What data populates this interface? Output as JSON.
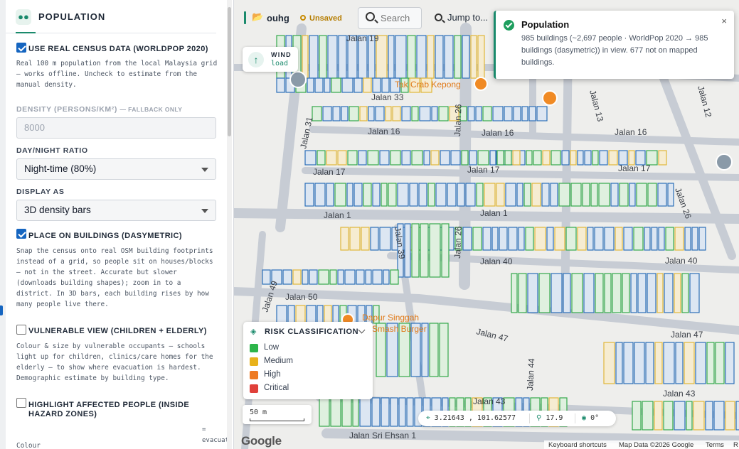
{
  "panel": {
    "title": "POPULATION",
    "census": {
      "checked": true,
      "label": "USE REAL CENSUS DATA (WORLDPOP 2020)",
      "desc": "Real 100 m population from the local Malaysia grid — works offline. Uncheck to estimate from the manual density."
    },
    "density": {
      "label": "DENSITY (PERSONS/KM²)",
      "note": "— FALLBACK ONLY",
      "value": "8000"
    },
    "ratio": {
      "label": "DAY/NIGHT RATIO",
      "selected": "Night-time (80%)"
    },
    "display": {
      "label": "DISPLAY AS",
      "selected": "3D density bars"
    },
    "dasymetric": {
      "checked": true,
      "label": "PLACE ON BUILDINGS (DASYMETRIC)",
      "desc": "Snap the census onto real OSM building footprints instead of a grid, so people sit on houses/blocks — not in the street. Accurate but slower (downloads building shapes); zoom in to a district. In 3D bars, each building rises by how many people live there."
    },
    "vulnerable": {
      "checked": false,
      "label": "VULNERABLE VIEW (CHILDREN + ELDERLY)",
      "desc": "Colour & size by vulnerable occupants — schools light up for children, clinics/care homes for the elderly — to show where evacuation is hardest. Demographic estimate by building type."
    },
    "affected": {
      "checked": false,
      "label": "HIGHLIGHT AFFECTED PEOPLE (INSIDE HAZARD ZONES)"
    },
    "bottom_left": "Colour",
    "bottom_right": "= evacuat"
  },
  "topbar": {
    "project": "ouhg",
    "status": "Unsaved",
    "search_placeholder": "Search",
    "jump_label": "Jump to..."
  },
  "wind": {
    "title": "WIND",
    "value": "load"
  },
  "toast": {
    "title": "Population",
    "message": "985 buildings (~2,697 people · WorldPop 2020 → 985 buildings (dasymetric)) in view. 677 not on mapped buildings.",
    "close": "×"
  },
  "legend": {
    "title": "RISK CLASSIFICATION",
    "items": [
      {
        "label": "Low",
        "color": "#2db54a"
      },
      {
        "label": "Medium",
        "color": "#e8b21b"
      },
      {
        "label": "High",
        "color": "#ee7a22"
      },
      {
        "label": "Critical",
        "color": "#e0403a"
      }
    ]
  },
  "scale": "50 m",
  "coords": {
    "latlng": "3.21643 , 101.62577",
    "zoom": "17.9",
    "bearing": "0°"
  },
  "map_labels": {
    "jalan19": "Jalan 19",
    "jalan33": "Jalan 33",
    "jalan31": "Jalan 31",
    "jalan16a": "Jalan 16",
    "jalan16b": "Jalan 16",
    "jalan16c": "Jalan 16",
    "jalan17a": "Jalan 17",
    "jalan17b": "Jalan 17",
    "jalan17c": "Jalan 17",
    "jalan26a": "Jalan 26",
    "jalan26b": "Jalan 26",
    "jalan26c": "Jalan 26",
    "jalan12": "Jalan 12",
    "jalan13": "Jalan 13",
    "jalan1a": "Jalan 1",
    "jalan1b": "Jalan 1",
    "jalan39": "Jalan 39",
    "jalan40a": "Jalan 40",
    "jalan40b": "Jalan 40",
    "jalan49": "Jalan 49",
    "jalan50": "Jalan 50",
    "jalan47a": "Jalan 47",
    "jalan47b": "Jalan 47",
    "jalan44": "Jalan 44",
    "jalan43a": "Jalan 43",
    "jalan43b": "Jalan 43",
    "jalansriehsan": "Jalan Sri Ehsan 1",
    "poi_tak_crab": "Tak Crab Kepong",
    "poi_dapur": "Dapur Singgah",
    "poi_smash": "Smash Burger"
  },
  "footer": {
    "shortcuts": "Keyboard shortcuts",
    "mapdata": "Map Data ©2026 Google",
    "terms": "Terms",
    "report": "R"
  },
  "google_logo": "Google"
}
